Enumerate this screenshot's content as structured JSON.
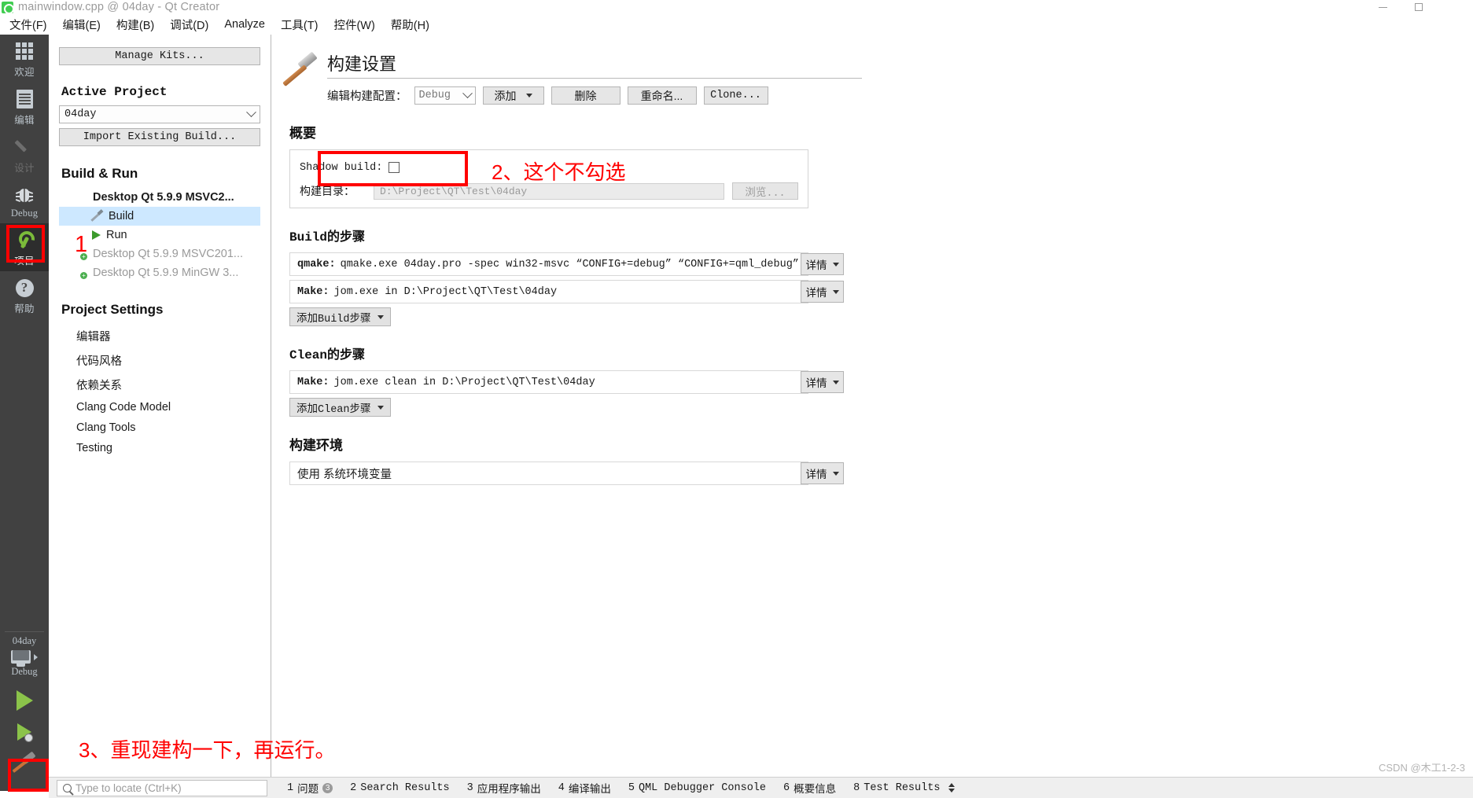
{
  "window": {
    "title": "mainwindow.cpp @ 04day - Qt Creator",
    "app_icon": "qt-logo-icon",
    "minimize_label": "—",
    "maximize_label": "□",
    "close_label": "✕"
  },
  "menubar": [
    {
      "label": "文件(F)",
      "key": "F"
    },
    {
      "label": "编辑(E)",
      "key": "E"
    },
    {
      "label": "构建(B)",
      "key": "B"
    },
    {
      "label": "调试(D)",
      "key": "D"
    },
    {
      "label": "Analyze",
      "key": "A"
    },
    {
      "label": "工具(T)",
      "key": "T"
    },
    {
      "label": "控件(W)",
      "key": "W"
    },
    {
      "label": "帮助(H)",
      "key": "H"
    }
  ],
  "modebar": {
    "items": [
      {
        "label": "欢迎",
        "icon": "grid-icon",
        "state": "normal"
      },
      {
        "label": "编辑",
        "icon": "document-icon",
        "state": "normal"
      },
      {
        "label": "设计",
        "icon": "pencil-icon",
        "state": "disabled"
      },
      {
        "label": "Debug",
        "icon": "bug-icon",
        "state": "normal"
      },
      {
        "label": "项目",
        "icon": "wrench-icon",
        "state": "active"
      },
      {
        "label": "帮助",
        "icon": "help-icon",
        "state": "normal"
      }
    ],
    "kit_selector": {
      "project": "04day",
      "icon": "monitor-icon",
      "build_config": "Debug"
    },
    "run_buttons": [
      {
        "name": "run-button",
        "icon": "play-icon"
      },
      {
        "name": "debug-button",
        "icon": "play-bug-icon"
      },
      {
        "name": "build-button",
        "icon": "hammer-icon"
      }
    ]
  },
  "project_panel": {
    "manage_kits_label": "Manage Kits...",
    "active_project_heading": "Active Project",
    "active_project_value": "04day",
    "import_build_label": "Import Existing Build...",
    "build_run_heading": "Build & Run",
    "kits": [
      {
        "label": "Desktop Qt 5.9.9 MSVC2...",
        "state": "active",
        "icon": "monitor-icon"
      },
      {
        "label": "Build",
        "state": "selected",
        "icon": "build-icon",
        "level": "child"
      },
      {
        "label": "Run",
        "state": "normal",
        "icon": "run-icon",
        "level": "child"
      },
      {
        "label": "Desktop Qt 5.9.9 MSVC201...",
        "state": "disabled",
        "icon": "monitor-add-icon"
      },
      {
        "label": "Desktop Qt 5.9.9 MinGW 3...",
        "state": "disabled",
        "icon": "monitor-add-icon"
      }
    ],
    "project_settings_heading": "Project Settings",
    "settings_items": [
      {
        "label": "编辑器"
      },
      {
        "label": "代码风格"
      },
      {
        "label": "依赖关系"
      },
      {
        "label": "Clang Code Model"
      },
      {
        "label": "Clang Tools"
      },
      {
        "label": "Testing"
      }
    ]
  },
  "main": {
    "title": "构建设置",
    "title_icon": "hammer-icon",
    "toolbar": {
      "edit_config_label": "编辑构建配置：",
      "config_value": "Debug",
      "add_label": "添加",
      "remove_label": "删除",
      "rename_label": "重命名...",
      "clone_label": "Clone..."
    },
    "summary": {
      "heading": "概要",
      "shadow_build_label": "Shadow build:",
      "shadow_build_checked": false,
      "build_dir_label": "构建目录：",
      "build_dir_value": "D:\\Project\\QT\\Test\\04day",
      "browse_label": "浏览..."
    },
    "build_steps": {
      "heading": "Build的步骤",
      "steps": [
        {
          "tool": "qmake:",
          "command": "qmake.exe 04day.pro -spec win32-msvc “CONFIG+=debug” “CONFIG+=qml_debug”",
          "details_label": "详情"
        },
        {
          "tool": "Make:",
          "command": "jom.exe in D:\\Project\\QT\\Test\\04day",
          "details_label": "详情"
        }
      ],
      "add_label": "添加Build步骤"
    },
    "clean_steps": {
      "heading": "Clean的步骤",
      "steps": [
        {
          "tool": "Make:",
          "command": "jom.exe clean in D:\\Project\\QT\\Test\\04day",
          "details_label": "详情"
        }
      ],
      "add_label": "添加Clean步骤"
    },
    "build_env": {
      "heading": "构建环境",
      "row_label": "使用 系统环境变量",
      "details_label": "详情"
    }
  },
  "annotations": {
    "color": "#ff0000",
    "step1": "1",
    "step2": "2、这个不勾选",
    "step3": "3、重现建构一下，再运行。"
  },
  "statusbar": {
    "locator_placeholder": "Type to locate (Ctrl+K)",
    "locator_icon": "search-icon",
    "panes": [
      {
        "num": "1",
        "label": "问题",
        "badge": "3"
      },
      {
        "num": "2",
        "label": "Search Results",
        "badge": ""
      },
      {
        "num": "3",
        "label": "应用程序输出",
        "badge": ""
      },
      {
        "num": "4",
        "label": "编译输出",
        "badge": ""
      },
      {
        "num": "5",
        "label": "QML Debugger Console",
        "badge": ""
      },
      {
        "num": "6",
        "label": "概要信息",
        "badge": ""
      },
      {
        "num": "8",
        "label": "Test Results",
        "badge": ""
      }
    ]
  },
  "watermark": "CSDN @木工1-2-3"
}
